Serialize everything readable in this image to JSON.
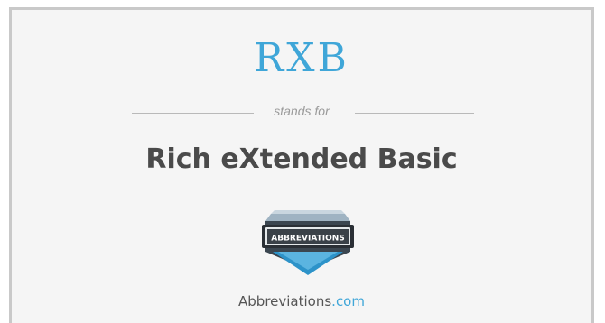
{
  "acronym": "RXB",
  "stands_for": "stands for",
  "expansion": "Rich eXtended Basic",
  "logo": {
    "icon": "abbreviations-logo-icon",
    "text": "ABBREVIATIONS"
  },
  "site": {
    "name": "Abbreviations",
    "tld": ".com"
  },
  "colors": {
    "accent": "#3fa6d8",
    "heading": "#4a4a4a",
    "muted": "#9a9a9a",
    "background": "#f5f5f5",
    "border": "#c9c9c9"
  }
}
